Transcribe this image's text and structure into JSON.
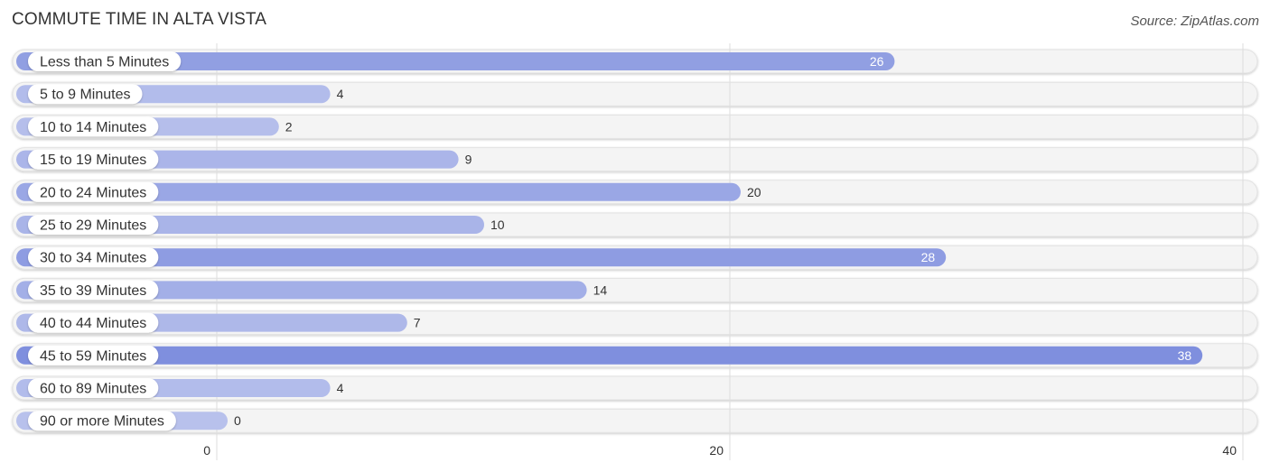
{
  "header": {
    "title": "COMMUTE TIME IN ALTA VISTA",
    "source": "Source: ZipAtlas.com"
  },
  "chart_data": {
    "type": "bar",
    "orientation": "horizontal",
    "title": "COMMUTE TIME IN ALTA VISTA",
    "source": "Source: ZipAtlas.com",
    "xlabel": "",
    "ylabel": "",
    "categories": [
      "Less than 5 Minutes",
      "5 to 9 Minutes",
      "10 to 14 Minutes",
      "15 to 19 Minutes",
      "20 to 24 Minutes",
      "25 to 29 Minutes",
      "30 to 34 Minutes",
      "35 to 39 Minutes",
      "40 to 44 Minutes",
      "45 to 59 Minutes",
      "60 to 89 Minutes",
      "90 or more Minutes"
    ],
    "values": [
      26,
      4,
      2,
      9,
      20,
      10,
      28,
      14,
      7,
      38,
      4,
      0
    ],
    "xlim": [
      0,
      40
    ],
    "xticks": [
      0,
      20,
      40
    ],
    "grid": true,
    "colors": {
      "bar_low": "#b8c1ec",
      "bar_high": "#7f8fde",
      "track": "#f4f4f4"
    }
  }
}
